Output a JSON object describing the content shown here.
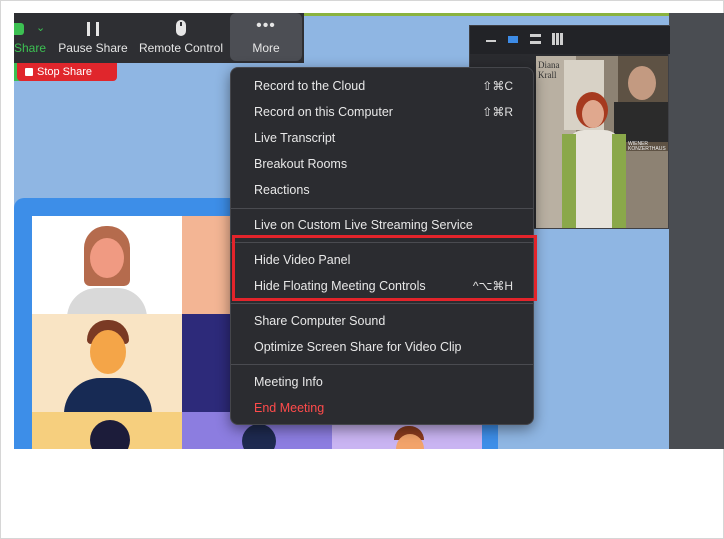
{
  "toolbar": {
    "share_label": "Share",
    "pause_label": "Pause Share",
    "remote_label": "Remote Control",
    "more_label": "More",
    "stop_share_label": "Stop Share"
  },
  "video_panel": {
    "poster_text": "Diana Krall",
    "venue_text": "WIENER KONZERTHAUS"
  },
  "menu": {
    "items": [
      {
        "label": "Record to the Cloud",
        "shortcut": "⇧⌘C"
      },
      {
        "label": "Record on this Computer",
        "shortcut": "⇧⌘R"
      },
      {
        "label": "Live Transcript",
        "shortcut": ""
      },
      {
        "label": "Breakout Rooms",
        "shortcut": ""
      },
      {
        "label": "Reactions",
        "shortcut": ""
      },
      {
        "label": "Live on Custom Live Streaming Service",
        "shortcut": ""
      },
      {
        "label": "Hide Video Panel",
        "shortcut": ""
      },
      {
        "label": "Hide Floating Meeting Controls",
        "shortcut": "^⌥⌘H"
      },
      {
        "label": "Share Computer Sound",
        "shortcut": ""
      },
      {
        "label": "Optimize Screen Share for Video Clip",
        "shortcut": ""
      },
      {
        "label": "Meeting Info",
        "shortcut": ""
      },
      {
        "label": "End Meeting",
        "shortcut": ""
      }
    ]
  },
  "colors": {
    "toolbar_bg": "#2e2f33",
    "menu_bg": "#2b2c30",
    "stop_share": "#e0262c",
    "highlight": "#e3242b",
    "end_meeting": "#ff4b4b"
  }
}
